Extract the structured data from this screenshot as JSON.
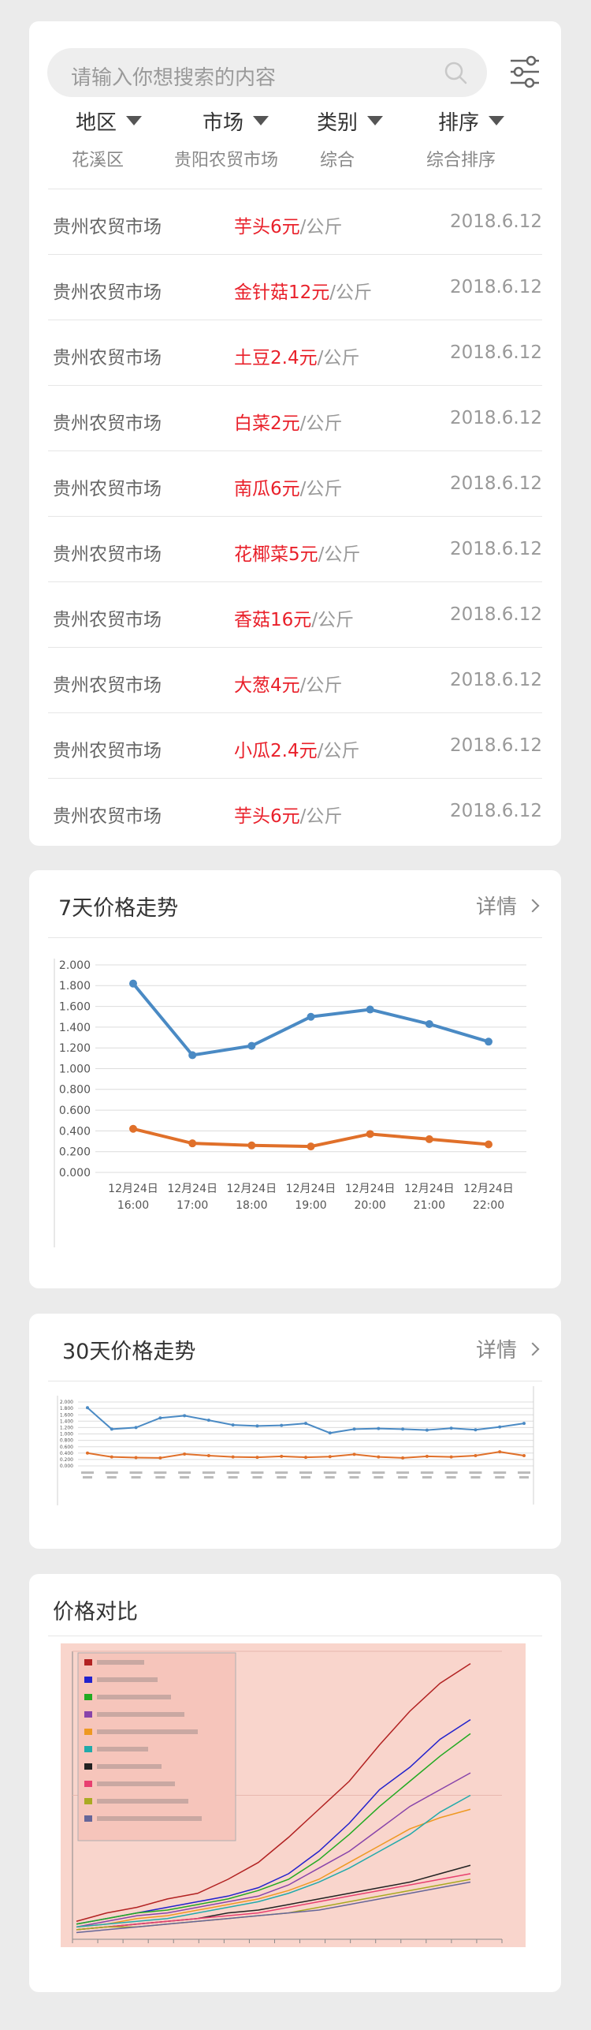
{
  "search": {
    "placeholder": "请输入你想搜索的内容"
  },
  "filters": [
    {
      "label": "地区",
      "value": "花溪区"
    },
    {
      "label": "市场",
      "value": "贵阳农贸市场"
    },
    {
      "label": "类别",
      "value": "综合"
    },
    {
      "label": "排序",
      "value": "综合排序"
    }
  ],
  "rows": [
    {
      "market": "贵州农贸市场",
      "item_price": "芋头6元",
      "unit": "/公斤",
      "date": "2018.6.12"
    },
    {
      "market": "贵州农贸市场",
      "item_price": "金针菇12元",
      "unit": "/公斤",
      "date": "2018.6.12"
    },
    {
      "market": "贵州农贸市场",
      "item_price": "土豆2.4元",
      "unit": "/公斤",
      "date": "2018.6.12"
    },
    {
      "market": "贵州农贸市场",
      "item_price": "白菜2元",
      "unit": "/公斤",
      "date": "2018.6.12"
    },
    {
      "market": "贵州农贸市场",
      "item_price": "南瓜6元",
      "unit": "/公斤",
      "date": "2018.6.12"
    },
    {
      "market": "贵州农贸市场",
      "item_price": "花椰菜5元",
      "unit": "/公斤",
      "date": "2018.6.12"
    },
    {
      "market": "贵州农贸市场",
      "item_price": "香菇16元",
      "unit": "/公斤",
      "date": "2018.6.12"
    },
    {
      "market": "贵州农贸市场",
      "item_price": "大葱4元",
      "unit": "/公斤",
      "date": "2018.6.12"
    },
    {
      "market": "贵州农贸市场",
      "item_price": "小瓜2.4元",
      "unit": "/公斤",
      "date": "2018.6.12"
    },
    {
      "market": "贵州农贸市场",
      "item_price": "芋头6元",
      "unit": "/公斤",
      "date": "2018.6.12"
    }
  ],
  "trend7": {
    "title": "7天价格走势",
    "detail_label": "详情"
  },
  "trend30": {
    "title": "30天价格走势",
    "detail_label": "详情"
  },
  "compare": {
    "title": "价格对比"
  },
  "colors": {
    "accent_red": "#e9202a",
    "series_blue": "#4a8ac4",
    "series_orange": "#e0702a",
    "compare_bg": "#f9d5cc"
  },
  "chart_data": [
    {
      "type": "line",
      "categories": [
        "12月24日 16:00",
        "12月24日 17:00",
        "12月24日 18:00",
        "12月24日 19:00",
        "12月24日 20:00",
        "12月24日 21:00",
        "12月24日 22:00"
      ],
      "ylim": [
        0,
        2
      ],
      "yticks": [
        "0.000",
        "0.200",
        "0.400",
        "0.600",
        "0.800",
        "1.000",
        "1.200",
        "1.400",
        "1.600",
        "1.800",
        "2.000"
      ],
      "grid": true,
      "series": [
        {
          "values": [
            1.82,
            1.13,
            1.22,
            1.5,
            1.57,
            1.43,
            1.26
          ],
          "color": "#4a8ac4"
        },
        {
          "values": [
            0.42,
            0.28,
            0.26,
            0.25,
            0.37,
            0.32,
            0.27
          ],
          "color": "#e0702a"
        }
      ]
    },
    {
      "type": "line",
      "ylim": [
        0,
        2
      ],
      "yticks": [
        "0.000",
        "0.200",
        "0.400",
        "0.600",
        "0.800",
        "1.000",
        "1.200",
        "1.400",
        "1.600",
        "1.800",
        "2.000"
      ],
      "grid": true,
      "series": [
        {
          "values": [
            1.82,
            1.15,
            1.2,
            1.5,
            1.57,
            1.43,
            1.28,
            1.25,
            1.27,
            1.33,
            1.03,
            1.15,
            1.17,
            1.15,
            1.12,
            1.18,
            1.13,
            1.22,
            1.33
          ],
          "color": "#4a8ac4"
        },
        {
          "values": [
            0.4,
            0.28,
            0.26,
            0.25,
            0.37,
            0.32,
            0.28,
            0.27,
            0.3,
            0.27,
            0.29,
            0.36,
            0.28,
            0.25,
            0.3,
            0.28,
            0.32,
            0.44,
            0.32
          ],
          "color": "#e0702a"
        }
      ]
    },
    {
      "type": "line",
      "ylim": [
        0,
        100
      ],
      "grid": true,
      "legend": "top-left",
      "background": "#f9d5cc",
      "series": [
        {
          "color": "#b22222",
          "values": [
            5,
            8,
            10,
            13,
            15,
            20,
            26,
            35,
            45,
            55,
            68,
            80,
            90,
            97
          ]
        },
        {
          "color": "#2222cc",
          "values": [
            4,
            6,
            8,
            10,
            12,
            14,
            17,
            22,
            30,
            40,
            52,
            60,
            70,
            77
          ]
        },
        {
          "color": "#22aa22",
          "values": [
            4,
            6,
            8,
            9,
            11,
            13,
            16,
            20,
            27,
            36,
            46,
            55,
            64,
            72
          ]
        },
        {
          "color": "#8844aa",
          "values": [
            3,
            5,
            7,
            8,
            10,
            12,
            14,
            18,
            24,
            30,
            38,
            46,
            52,
            58
          ]
        },
        {
          "color": "#ee9922",
          "values": [
            3,
            4,
            6,
            7,
            9,
            11,
            13,
            16,
            20,
            26,
            32,
            38,
            42,
            45
          ]
        },
        {
          "color": "#22aaaa",
          "values": [
            3,
            4,
            5,
            6,
            8,
            10,
            12,
            15,
            19,
            24,
            30,
            36,
            44,
            50
          ]
        },
        {
          "color": "#222222",
          "values": [
            2,
            3,
            4,
            5,
            6,
            8,
            9,
            11,
            13,
            15,
            17,
            19,
            22,
            25
          ]
        },
        {
          "color": "#e84070",
          "values": [
            2,
            3,
            4,
            5,
            6,
            7,
            8,
            10,
            12,
            14,
            16,
            18,
            20,
            22
          ]
        },
        {
          "color": "#aaaa22",
          "values": [
            2,
            3,
            3,
            4,
            5,
            6,
            7,
            8,
            10,
            12,
            14,
            16,
            18,
            20
          ]
        },
        {
          "color": "#666699",
          "values": [
            1,
            2,
            3,
            4,
            5,
            6,
            7,
            8,
            9,
            11,
            13,
            15,
            17,
            19
          ]
        }
      ]
    }
  ]
}
